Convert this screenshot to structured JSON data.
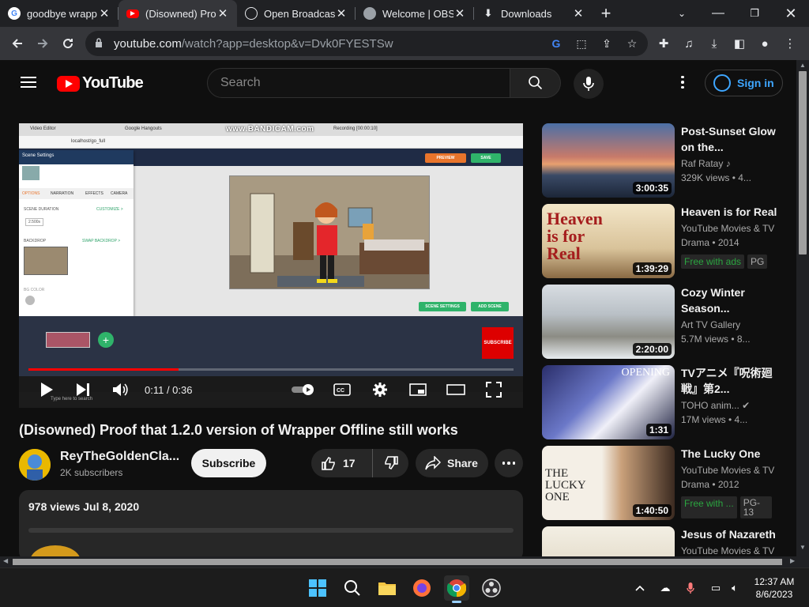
{
  "browser": {
    "tabs": [
      {
        "title": "goodbye wrapp",
        "active": false
      },
      {
        "title": "(Disowned) Pro",
        "active": true
      },
      {
        "title": "Open Broadcast",
        "active": false
      },
      {
        "title": "Welcome | OBS",
        "active": false
      },
      {
        "title": "Downloads",
        "active": false
      }
    ],
    "url_host": "youtube.com",
    "url_path": "/watch?app=desktop&v=Dvk0FYESTSw"
  },
  "youtube": {
    "logo_text": "YouTube",
    "search_placeholder": "Search",
    "sign_in": "Sign in",
    "video": {
      "title": "(Disowned) Proof that 1.2.0 version of Wrapper Offline still works",
      "time_current": "0:11",
      "time_total": "0:36",
      "time_display": "0:11 / 0:36",
      "progress": 0.31,
      "watermark": "www.BANDICAM.com",
      "inner": {
        "scene_settings": "Scene Settings",
        "tab_options": "OPTIONS",
        "tab_narration": "NARRATION",
        "tab_effects": "EFFECTS",
        "tab_camera": "CAMERA",
        "scene_duration": "SCENE DURATION",
        "customize": "CUSTOMIZE >",
        "duration_value": "2.500s",
        "backdrop": "BACKDROP",
        "swap_backdrop": "SWAP BACKDROP >",
        "bg_color": "BG COLOR",
        "preview": "PREVIEW",
        "save": "SAVE",
        "scene_settings_btn": "SCENE SETTINGS",
        "add_scene_btn": "ADD SCENE",
        "subscribe_badge": "SUBSCRIBE",
        "url": "localhost/go_full",
        "tab1": "Video Editor",
        "tab2": "Google Hangouts",
        "recording": "Recording [00:00:10]",
        "taskbar_search": "Type here to search"
      }
    },
    "channel": {
      "name": "ReyTheGoldenCla...",
      "subscribers": "2K subscribers",
      "subscribe_label": "Subscribe"
    },
    "actions": {
      "likes": "17",
      "share": "Share"
    },
    "description": {
      "meta": "978 views  Jul 8, 2020"
    },
    "related": [
      {
        "title": "Post-Sunset Glow on the...",
        "channel": "Raf Ratay",
        "views": "329K views • 4...",
        "duration": "3:00:35"
      },
      {
        "title": "Heaven is for Real",
        "channel": "YouTube Movies & TV",
        "views": "Drama • 2014",
        "duration": "1:39:29",
        "badge": "Free with ads",
        "rating": "PG",
        "thumb_text": "Heaven is for Real"
      },
      {
        "title": "Cozy Winter Season...",
        "channel": "Art TV Gallery",
        "views": "5.7M views • 8...",
        "duration": "2:20:00"
      },
      {
        "title": "TVアニメ『呪術廻戦』第2...",
        "channel": "TOHO anim...",
        "views": "17M views • 4...",
        "duration": "1:31",
        "thumb_text": "OPENING"
      },
      {
        "title": "The Lucky One",
        "channel": "YouTube Movies & TV",
        "views": "Drama • 2012",
        "duration": "1:40:50",
        "badge": "Free with ...",
        "rating": "PG-13",
        "thumb_text": "THE LUCKY ONE"
      },
      {
        "title": "Jesus of Nazareth",
        "channel": "YouTube Movies & TV",
        "views": "",
        "duration": ""
      }
    ]
  },
  "taskbar": {
    "time": "12:37 AM",
    "date": "8/6/2023"
  },
  "colors": {
    "yt_red": "#ff0000",
    "link_blue": "#3ea6ff",
    "bg": "#0f0f0f"
  }
}
